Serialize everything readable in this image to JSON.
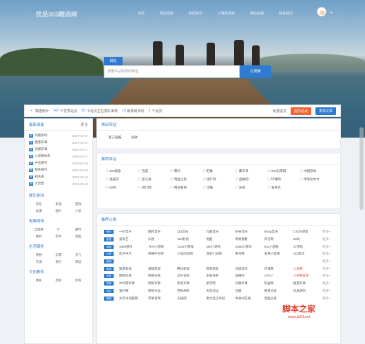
{
  "header": {
    "logo": "优品365精选网",
    "nav": [
      "首页",
      "网址导航",
      "新闻资讯",
      "计算机学院",
      "网站收藏",
      "联系我们"
    ]
  },
  "search": {
    "tab": "网址",
    "placeholder": "搜索本站收录的网址",
    "button": "Q 搜索"
  },
  "stats": {
    "label": "数据统计",
    "items": [
      {
        "n": "147",
        "t": "个优秀站点"
      },
      {
        "n": "10",
        "t": "个站点正在排队审核"
      },
      {
        "n": "10",
        "t": "篇新闻资讯"
      },
      {
        "n": "2",
        "t": "个会员"
      }
    ],
    "link": "免费提交",
    "btn1": "提交站点",
    "btn2": "发布文章"
  },
  "news": {
    "title": "最新收录",
    "more": "更多",
    "items": [
      {
        "tag": "网",
        "title": "凤凰争鸣",
        "date": "2019-03-17"
      },
      {
        "tag": "网",
        "title": "搜狐军事",
        "date": "2019-03-17"
      },
      {
        "tag": "网",
        "title": "凤凰军事",
        "date": "2019-03-17"
      },
      {
        "tag": "网",
        "title": "人民网体育",
        "date": "2019-03-17"
      },
      {
        "tag": "网",
        "title": "中信银行",
        "date": "2019-03-16"
      },
      {
        "tag": "网",
        "title": "招生银行",
        "date": "2019-03-16"
      },
      {
        "tag": "网",
        "title": "招农商",
        "date": "2019-03-16"
      },
      {
        "tag": "网",
        "title": "大智慧",
        "date": "2019-03-16"
      }
    ]
  },
  "categories": [
    {
      "title": "娱乐休闲",
      "items": [
        "音乐",
        "影视",
        "游戏",
        "动漫",
        "图片",
        "小说"
      ]
    },
    {
      "title": "电脑网络",
      "items": [
        "互联网",
        "IT",
        "硬件",
        "数码",
        "软件",
        "电脑"
      ]
    },
    {
      "title": "生活服务",
      "items": [
        "购物",
        "彩票",
        "天气",
        "交通",
        "银行",
        "家居"
      ]
    },
    {
      "title": "文化教育",
      "items": [
        "教育",
        "新闻",
        "体育"
      ]
    }
  ],
  "hot": {
    "title": "快审网站",
    "items": [
      "百宁查酷",
      "谷歌"
    ]
  },
  "recommend": {
    "title": "推荐网站",
    "items": [
      "360搜索",
      "百度",
      "腾讯",
      "赶集",
      "薰衣草",
      "500彩票网",
      "中国移动",
      "银座贷",
      "亚马逊",
      "电脑之家",
      "煤矿网",
      "直播吧",
      "环球网",
      "伟易达中文",
      "58同",
      "同行网",
      "网易看看",
      "优酷",
      "乐视",
      "爱奇艺"
    ]
  },
  "recCat": {
    "title": "推荐分类",
    "more": "更多+",
    "rows": [
      {
        "tag": "音乐",
        "cells": [
          "一听音乐",
          "酷狗音乐",
          "QQ音乐",
          "九酷音乐",
          "虾米音乐",
          "5sing音乐",
          "CSDN博客"
        ]
      },
      {
        "tag": "影视",
        "cells": [
          "爱奇艺",
          "乐视",
          "360影视",
          "优酷",
          "网易看看",
          "风行网",
          "58同"
        ]
      },
      {
        "tag": "游戏",
        "cells": [
          "4399游戏",
          "7k7k小游戏",
          "2144小游戏",
          "360小游戏",
          "3366小游戏",
          "543小游戏",
          "37游戏"
        ]
      },
      {
        "tag": "小说",
        "cells": [
          "起点中文",
          "纵横中文网",
          "小说阅读网",
          "逐浪小说网",
          "看书网",
          "金佛小说网",
          "QQ阅读"
        ]
      },
      {
        "tag": "新闻",
        "cells": [
          "",
          "",
          "",
          "",
          "",
          "",
          ""
        ]
      },
      {
        "tag": "新闻",
        "cells": [
          "数游新闻",
          "搜狐新闻",
          "腾讯新闻",
          "网易新闻",
          "凤凰资讯",
          "环球网",
          "人民网"
        ]
      },
      {
        "tag": "体育",
        "cells": [
          "网易体育",
          "网易体育",
          "虎扑体育",
          "乐视体育",
          "直播吧",
          "CNTV",
          "人民网体育"
        ]
      },
      {
        "tag": "军事",
        "cells": [
          "中华网军事",
          "网易军事",
          "新浪军事",
          "星宇网",
          "凤凰军事",
          "铁血网",
          "搜狐军事"
        ]
      },
      {
        "tag": "论坛",
        "cells": [
          "猫扑网",
          "网易论坛",
          "西祠胡同",
          "天涯论坛",
          "豆瓣",
          "网易论坛",
          "凤凰争鸣"
        ]
      },
      {
        "tag": "购物",
        "cells": [
          "太平洋电脑网",
          "苹果官网",
          "天极网",
          "图文电子商城",
          "中关村在线",
          "电脑之家",
          ""
        ]
      }
    ]
  },
  "watermark": {
    "main": "脚本之家",
    "url": "www.jb51.net"
  },
  "colors": {
    "accent": "#2d7cd1",
    "orange": "#f06432"
  }
}
